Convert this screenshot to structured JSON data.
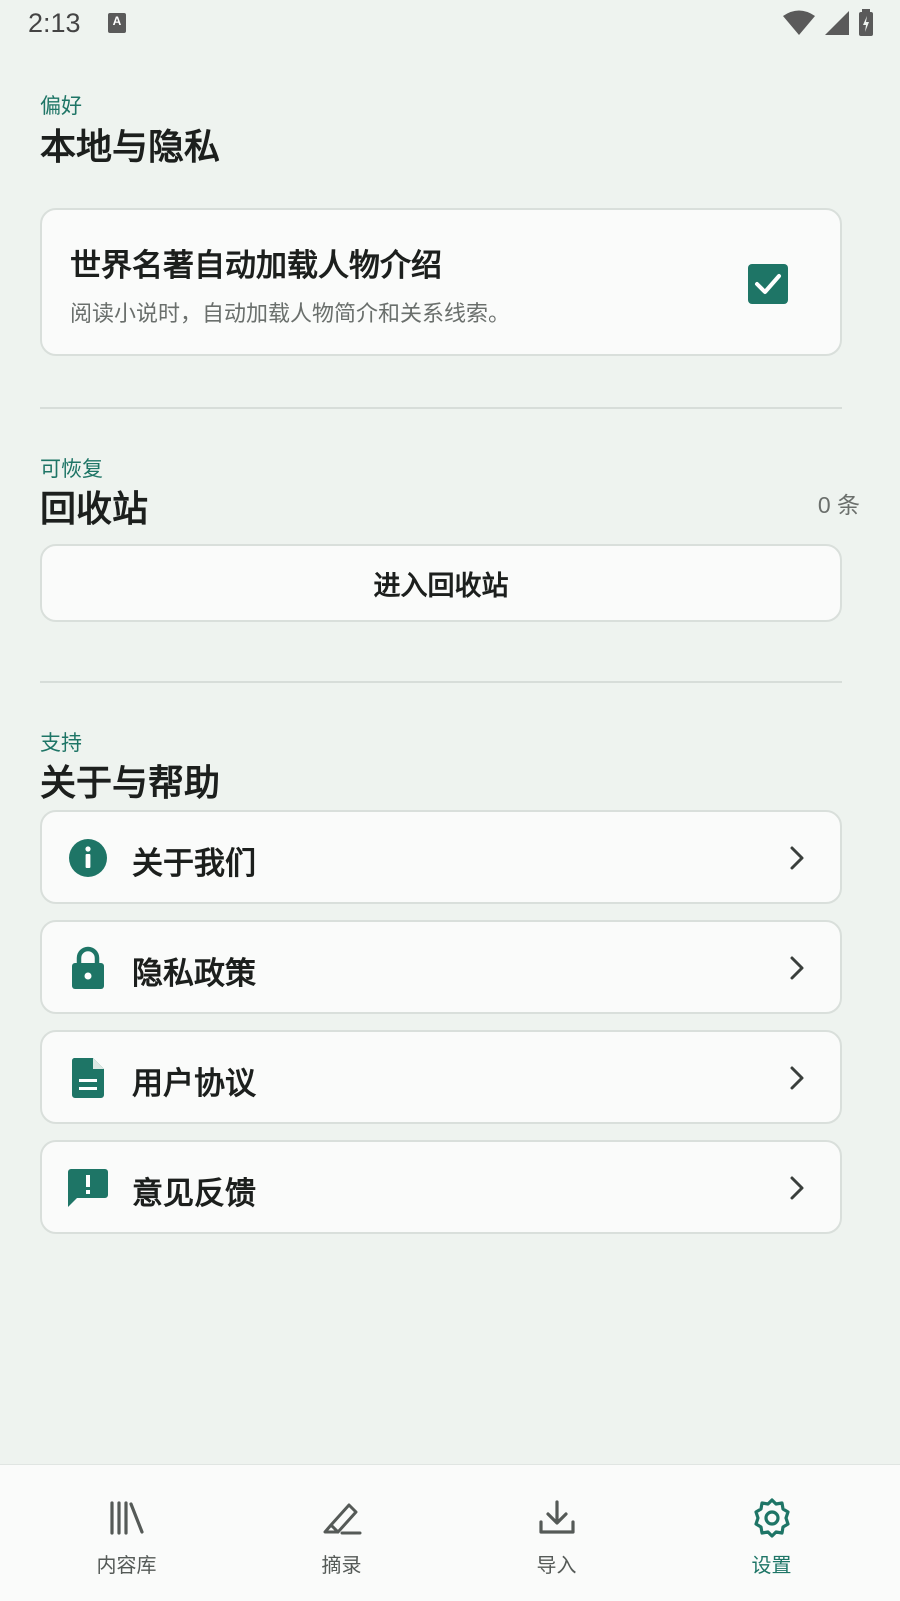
{
  "status_bar": {
    "time": "2:13",
    "notification_letter": "A"
  },
  "preferences": {
    "eyebrow": "偏好",
    "title": "本地与隐私",
    "items": [
      {
        "title": "世界名著自动加载人物介绍",
        "description": "阅读小说时，自动加载人物简介和关系线索。",
        "checked": true
      }
    ]
  },
  "recycle": {
    "eyebrow": "可恢复",
    "title": "回收站",
    "count": "0 条",
    "button_label": "进入回收站"
  },
  "support": {
    "eyebrow": "支持",
    "title": "关于与帮助",
    "items": [
      {
        "label": "关于我们",
        "icon": "info-icon"
      },
      {
        "label": "隐私政策",
        "icon": "lock-icon"
      },
      {
        "label": "用户协议",
        "icon": "document-icon"
      },
      {
        "label": "意见反馈",
        "icon": "feedback-icon"
      }
    ]
  },
  "bottom_nav": {
    "active": "设置",
    "items": [
      {
        "label": "内容库",
        "icon": "library-icon"
      },
      {
        "label": "摘录",
        "icon": "highlighter-icon"
      },
      {
        "label": "导入",
        "icon": "download-icon"
      },
      {
        "label": "设置",
        "icon": "settings-icon"
      }
    ]
  },
  "colors": {
    "accent": "#1E7566",
    "background": "#EEF3EF",
    "card": "#FAFBFA",
    "border": "#D9DFDB"
  }
}
